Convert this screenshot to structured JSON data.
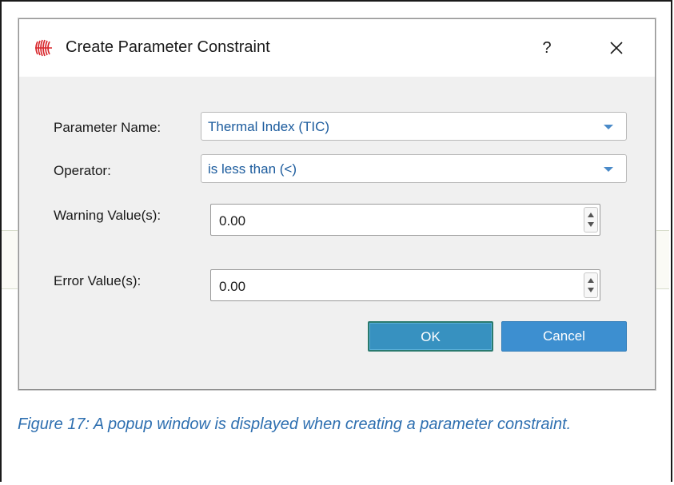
{
  "dialog": {
    "title": "Create Parameter Constraint",
    "help_label": "?",
    "close_label": "×",
    "app_icon": "parameter-app-icon"
  },
  "form": {
    "parameter_name": {
      "label": "Parameter Name:",
      "value": "Thermal Index (TIC)"
    },
    "operator": {
      "label": "Operator:",
      "value": "is less than (<)"
    },
    "warning_value": {
      "label": "Warning Value(s):",
      "value": "0.00"
    },
    "error_value": {
      "label": "Error Value(s):",
      "value": "0.00"
    }
  },
  "buttons": {
    "ok_label": "OK",
    "cancel_label": "Cancel"
  },
  "caption": "Figure 17: A popup window is displayed when creating a parameter constraint.",
  "colors": {
    "accent": "#3d8fd0",
    "combo_text": "#1b5b9d",
    "caption": "#2e6fb0",
    "icon": "#d8262b"
  }
}
